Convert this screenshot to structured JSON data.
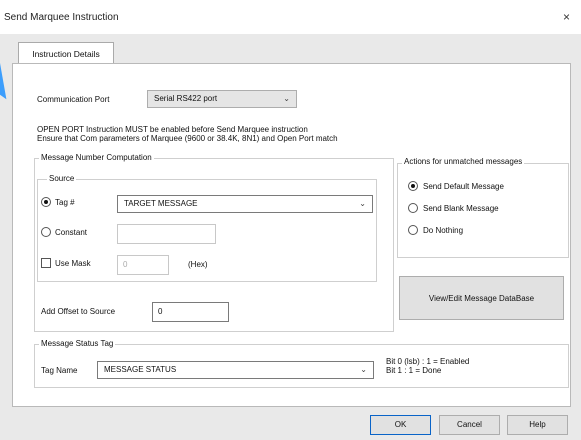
{
  "window": {
    "title": "Send Marquee Instruction",
    "close_glyph": "×"
  },
  "tabs": [
    {
      "label": "Instruction Details"
    }
  ],
  "comm": {
    "label": "Communication Port",
    "value": "Serial RS422 port"
  },
  "notes": {
    "line1": "OPEN PORT Instruction MUST be enabled before Send Marquee instruction",
    "line2": "Ensure that Com parameters of Marquee (9600 or 38.4K, 8N1) and Open Port match"
  },
  "computation": {
    "group_label": "Message Number Computation",
    "source_label": "Source",
    "tag_label": "Tag #",
    "tag_value": "TARGET MESSAGE",
    "constant_label": "Constant",
    "constant_value": "",
    "use_mask_label": "Use Mask",
    "mask_value": "0",
    "hex_label": "(Hex)",
    "offset_label": "Add Offset to Source",
    "offset_value": "0"
  },
  "actions": {
    "group_label": "Actions for unmatched messages",
    "options": [
      "Send Default Message",
      "Send Blank Message",
      "Do Nothing"
    ],
    "selected": 0
  },
  "database_button": "View/Edit Message DataBase",
  "status": {
    "group_label": "Message Status Tag",
    "tag_name_label": "Tag Name",
    "tag_name_value": "MESSAGE STATUS",
    "bit0": "Bit 0 (lsb) : 1 = Enabled",
    "bit1": "Bit 1 : 1 = Done"
  },
  "buttons": {
    "ok": "OK",
    "cancel": "Cancel",
    "help": "Help"
  },
  "colors": {
    "accent_arrow": "#1e90ff",
    "dialog_bg": "#e9e9e9",
    "default_button_border": "#0a64c8"
  }
}
